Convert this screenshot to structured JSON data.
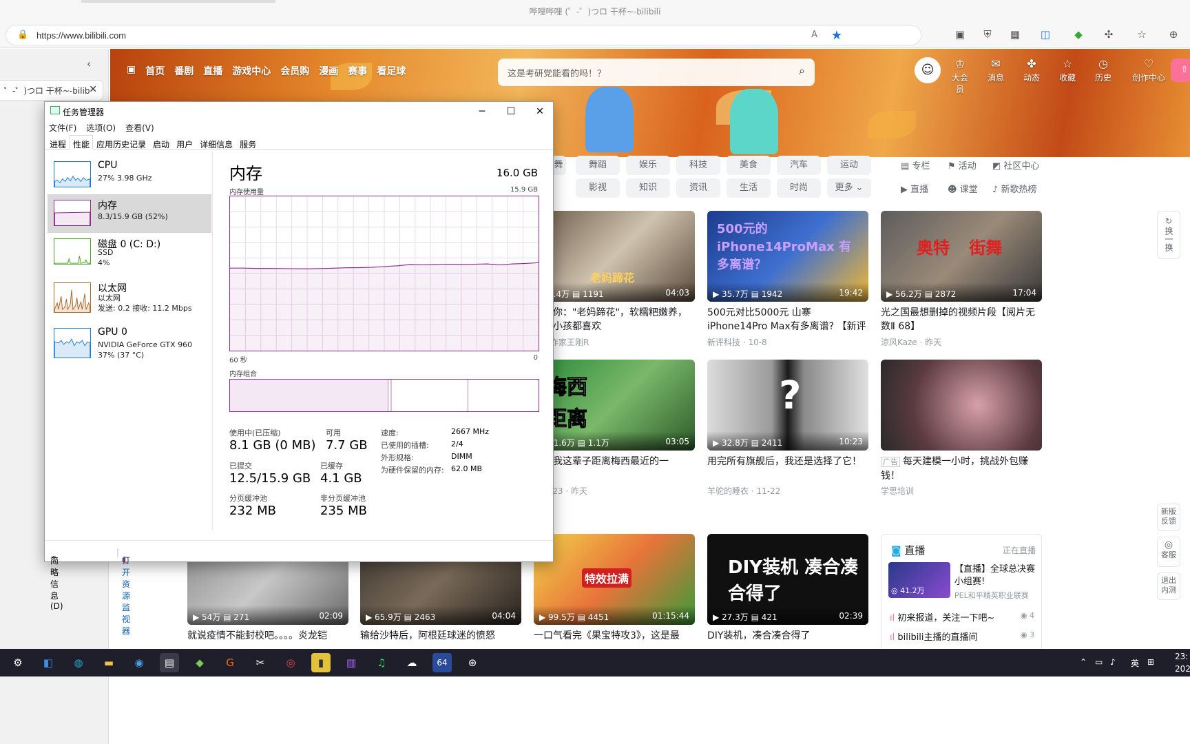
{
  "browser": {
    "window_title": "哔哩哔哩 (゜-゜)つロ 干杯~-bilibili",
    "url": "https://www.bilibili.com",
    "vtab_label": "゜-゜)つロ 干杯~-bilib"
  },
  "bili": {
    "nav": [
      "首页",
      "番剧",
      "直播",
      "游戏中心",
      "会员购",
      "漫画",
      "赛事",
      "看足球"
    ],
    "search_placeholder": "这是考研党能看的吗！？",
    "right_nav": [
      "大会员",
      "消息",
      "动态",
      "收藏",
      "历史",
      "创作中心"
    ],
    "categories_row1": [
      "舞蹈",
      "娱乐",
      "科技",
      "美食",
      "汽车",
      "运动"
    ],
    "categories_row2": [
      "影视",
      "知识",
      "资讯",
      "生活",
      "时尚",
      "更多"
    ],
    "side_links": [
      "专栏",
      "活动",
      "社区中心",
      "直播",
      "课堂",
      "新歌热榜"
    ],
    "refresh": "换一换",
    "cards": [
      {
        "views": "5.4万",
        "danmaku": "1191",
        "dur": "04:03",
        "title": "长教你：\"老妈蹄花\"，软糯粑嫩养，老人小孩都喜欢",
        "author": "美食作家王刚R",
        "overlay": "老妈蹄花"
      },
      {
        "views": "35.7万",
        "danmaku": "1942",
        "dur": "19:42",
        "title": "500元对比5000元 山寨iPhone14Pro Max有多离谱? 【新评×白叔】",
        "author": "新评科技 · 10-8",
        "overlay": "500元的 iPhone14ProMax 有多离谱？"
      },
      {
        "views": "56.2万",
        "danmaku": "2872",
        "dur": "17:04",
        "title": "光之国最想删掉的视频片段【阅片无数Ⅱ 68】",
        "author": "涼风Kaze · 昨天",
        "overlay": "奥特 街舞"
      },
      {
        "views": "41.6万",
        "danmaku": "1.1万",
        "dur": "03:05",
        "title": "能是我这辈子距离梅西最近的一",
        "author": "胜0423 · 昨天",
        "overlay": "梅西 距离"
      },
      {
        "views": "32.8万",
        "danmaku": "2411",
        "dur": "10:23",
        "title": "用完所有旗舰后，我还是选择了它！",
        "author": "羊驼的睡衣 · 11-22",
        "overlay": "?"
      },
      {
        "views": "",
        "danmaku": "",
        "dur": "",
        "title": "每天建模一小时，挑战外包赚钱！",
        "author": "学思培训",
        "ad": "广告"
      },
      {
        "views": "54万",
        "danmaku": "271",
        "dur": "02:09",
        "title": "就说疫情不能封校吧。。。。炎龙铠",
        "author": ""
      },
      {
        "views": "65.9万",
        "danmaku": "2463",
        "dur": "04:04",
        "title": "输给沙特后，阿根廷球迷的愤怒",
        "author": ""
      },
      {
        "views": "99.5万",
        "danmaku": "4451",
        "dur": "01:15:44",
        "title": "一口气看完《果宝特攻3》，这是最",
        "author": "",
        "overlay": "特效拉满"
      },
      {
        "views": "27.3万",
        "danmaku": "421",
        "dur": "02:39",
        "title": "DIY装机，凑合凑合得了",
        "author": "",
        "overlay": "DIY装机 凑合凑合得了"
      }
    ],
    "live": {
      "header": "直播",
      "status": "正在直播",
      "item1_title": "【直播】全球总决赛小组赛!",
      "item1_author": "PEL和平精英职业联赛",
      "item1_views": "41.2万",
      "list": [
        {
          "text": "初来报道，关注一下吧~",
          "count": "4"
        },
        {
          "text": "bilibili主播的直播间",
          "count": "3"
        }
      ]
    },
    "float": [
      "新版反馈",
      "客服",
      "退出内测"
    ]
  },
  "taskmgr": {
    "title": "任务管理器",
    "menu": [
      "文件(F)",
      "选项(O)",
      "查看(V)"
    ],
    "tabs": [
      "进程",
      "性能",
      "应用历史记录",
      "启动",
      "用户",
      "详细信息",
      "服务"
    ],
    "resources": [
      {
        "name": "CPU",
        "l2": "27% 3.98 GHz",
        "l3": "",
        "color": "#1a7bd1"
      },
      {
        "name": "内存",
        "l2": "8.3/15.9 GB (52%)",
        "l3": "",
        "color": "#8b2f8b"
      },
      {
        "name": "磁盘 0 (C: D:)",
        "l2": "SSD",
        "l3": "4%",
        "color": "#4da32c"
      },
      {
        "name": "以太网",
        "l2": "以太网",
        "l3": "发送: 0.2 接收: 11.2 Mbps",
        "color": "#a7662a"
      },
      {
        "name": "GPU 0",
        "l2": "NVIDIA GeForce GTX 960",
        "l3": "37% (37 °C)",
        "color": "#1a7bd1"
      }
    ],
    "heading": "内存",
    "total": "16.0 GB",
    "usage_label": "内存使用量",
    "usage_max": "15.9 GB",
    "time_left": "60 秒",
    "time_right": "0",
    "composition_label": "内存组合",
    "memory_usage_fraction": [
      0.535,
      0.535,
      0.533,
      0.533,
      0.532,
      0.531,
      0.53,
      0.532,
      0.534,
      0.537,
      0.538,
      0.54,
      0.545,
      0.55,
      0.558,
      0.556,
      0.558,
      0.56,
      0.558,
      0.56,
      0.562,
      0.556,
      0.562,
      0.565,
      0.57
    ],
    "stats": {
      "in_use_label": "使用中(已压缩)",
      "in_use": "8.1 GB (0 MB)",
      "available_label": "可用",
      "available": "7.7 GB",
      "committed_label": "已提交",
      "committed": "12.5/15.9 GB",
      "cached_label": "已缓存",
      "cached": "4.1 GB",
      "paged_label": "分页缓冲池",
      "paged": "232 MB",
      "nonpaged_label": "非分页缓冲池",
      "nonpaged": "235 MB"
    },
    "kv": [
      {
        "k": "速度:",
        "v": "2667 MHz"
      },
      {
        "k": "已使用的插槽:",
        "v": "2/4"
      },
      {
        "k": "外形规格:",
        "v": "DIMM"
      },
      {
        "k": "为硬件保留的内存:",
        "v": "62.0 MB"
      }
    ],
    "fewer_details": "简略信息(D)",
    "open_monitor": "打开资源监视器"
  },
  "taskbar": {
    "lang": "英",
    "time": "23:",
    "date": "202"
  }
}
